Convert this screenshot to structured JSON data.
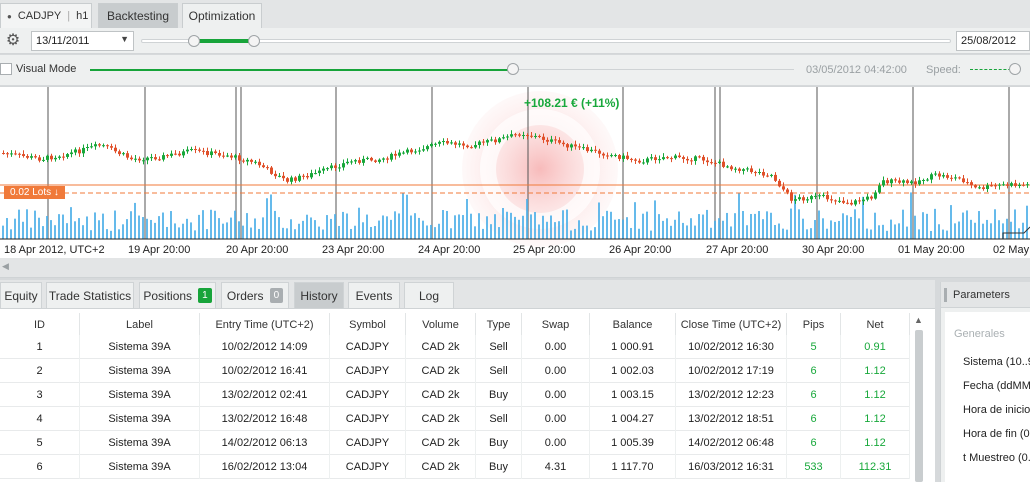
{
  "top_tabs": {
    "symbol": "CADJPY",
    "timeframe": "h1",
    "backtesting": "Backtesting",
    "optimization": "Optimization"
  },
  "date_range": {
    "from": "13/11/2011",
    "to": "25/08/2012"
  },
  "visual_mode": {
    "label": "Visual Mode",
    "current_time": "03/05/2012 04:42:00",
    "speed_label": "Speed:"
  },
  "chart": {
    "profit_label": "+108.21 € (+11%)",
    "lots_label": "0.02 Lots ↓",
    "x_labels": [
      "18 Apr 2012, UTC+2",
      "19 Apr 20:00",
      "20 Apr 20:00",
      "23 Apr 20:00",
      "24 Apr 20:00",
      "25 Apr 20:00",
      "26 Apr 20:00",
      "27 Apr 20:00",
      "30 Apr 20:00",
      "01 May 20:00",
      "02 May 2"
    ],
    "colors": {
      "up": "#18a83b",
      "down": "#e0502a",
      "volume": "#4aaee8",
      "order_line": "#f07a3a"
    }
  },
  "bottom_tabs": {
    "equity": "Equity",
    "trade_statistics": "Trade Statistics",
    "positions": "Positions",
    "positions_count": "1",
    "orders": "Orders",
    "orders_count": "0",
    "history": "History",
    "events": "Events",
    "log": "Log"
  },
  "history_table": {
    "columns": [
      "ID",
      "Label",
      "Entry Time (UTC+2)",
      "Symbol",
      "Volume",
      "Type",
      "Swap",
      "Balance",
      "Close Time (UTC+2)",
      "Pips",
      "Net"
    ],
    "rows": [
      [
        "1",
        "Sistema 39A",
        "10/02/2012 14:09",
        "CADJPY",
        "CAD 2k",
        "Sell",
        "0.00",
        "1 000.91",
        "10/02/2012 16:30",
        "5",
        "0.91"
      ],
      [
        "2",
        "Sistema 39A",
        "10/02/2012 16:41",
        "CADJPY",
        "CAD 2k",
        "Sell",
        "0.00",
        "1 002.03",
        "10/02/2012 17:19",
        "6",
        "1.12"
      ],
      [
        "3",
        "Sistema 39A",
        "13/02/2012 02:41",
        "CADJPY",
        "CAD 2k",
        "Buy",
        "0.00",
        "1 003.15",
        "13/02/2012 12:23",
        "6",
        "1.12"
      ],
      [
        "4",
        "Sistema 39A",
        "13/02/2012 16:48",
        "CADJPY",
        "CAD 2k",
        "Sell",
        "0.00",
        "1 004.27",
        "13/02/2012 18:51",
        "6",
        "1.12"
      ],
      [
        "5",
        "Sistema 39A",
        "14/02/2012 06:13",
        "CADJPY",
        "CAD 2k",
        "Buy",
        "0.00",
        "1 005.39",
        "14/02/2012 06:48",
        "6",
        "1.12"
      ],
      [
        "6",
        "Sistema 39A",
        "16/02/2012 13:04",
        "CADJPY",
        "CAD 2k",
        "Buy",
        "4.31",
        "1 117.70",
        "16/03/2012 16:31",
        "533",
        "112.31"
      ]
    ]
  },
  "parameters": {
    "title": "Parameters",
    "group": "Generales",
    "items": [
      "Sistema (10..9",
      "Fecha (ddMMy",
      "Hora de inicio",
      "Hora de fin (0",
      "t Muestreo (0."
    ]
  }
}
